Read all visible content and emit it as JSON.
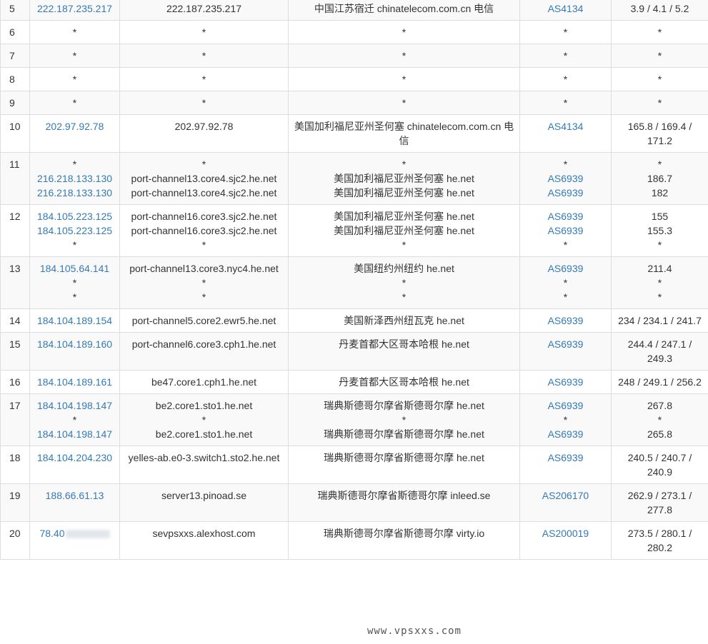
{
  "rows": [
    {
      "hop": "5",
      "ip": [
        "222.187.235.217"
      ],
      "host": [
        "222.187.235.217"
      ],
      "geo": [
        "中国江苏宿迁 chinatelecom.com.cn 电信"
      ],
      "as": [
        "AS4134"
      ],
      "rtt": [
        "3.9 / 4.1 / 5.2"
      ]
    },
    {
      "hop": "6",
      "ip": [
        "*"
      ],
      "host": [
        "*"
      ],
      "geo": [
        "*"
      ],
      "as": [
        "*"
      ],
      "rtt": [
        "*"
      ]
    },
    {
      "hop": "7",
      "ip": [
        "*"
      ],
      "host": [
        "*"
      ],
      "geo": [
        "*"
      ],
      "as": [
        "*"
      ],
      "rtt": [
        "*"
      ]
    },
    {
      "hop": "8",
      "ip": [
        "*"
      ],
      "host": [
        "*"
      ],
      "geo": [
        "*"
      ],
      "as": [
        "*"
      ],
      "rtt": [
        "*"
      ]
    },
    {
      "hop": "9",
      "ip": [
        "*"
      ],
      "host": [
        "*"
      ],
      "geo": [
        "*"
      ],
      "as": [
        "*"
      ],
      "rtt": [
        "*"
      ]
    },
    {
      "hop": "10",
      "ip": [
        "202.97.92.78"
      ],
      "host": [
        "202.97.92.78"
      ],
      "geo": [
        "美国加利福尼亚州圣何塞 chinatelecom.com.cn 电信"
      ],
      "as": [
        "AS4134"
      ],
      "rtt": [
        "165.8 / 169.4 / 171.2"
      ]
    },
    {
      "hop": "11",
      "ip": [
        "*",
        "216.218.133.130",
        "216.218.133.130"
      ],
      "host": [
        "*",
        "port-channel13.core4.sjc2.he.net",
        "port-channel13.core4.sjc2.he.net"
      ],
      "geo": [
        "*",
        "美国加利福尼亚州圣何塞 he.net",
        "美国加利福尼亚州圣何塞 he.net"
      ],
      "as": [
        "*",
        "AS6939",
        "AS6939"
      ],
      "rtt": [
        "*",
        "186.7",
        "182"
      ]
    },
    {
      "hop": "12",
      "ip": [
        "184.105.223.125",
        "184.105.223.125",
        "*"
      ],
      "host": [
        "port-channel16.core3.sjc2.he.net",
        "port-channel16.core3.sjc2.he.net",
        "*"
      ],
      "geo": [
        "美国加利福尼亚州圣何塞 he.net",
        "美国加利福尼亚州圣何塞 he.net",
        "*"
      ],
      "as": [
        "AS6939",
        "AS6939",
        "*"
      ],
      "rtt": [
        "155",
        "155.3",
        "*"
      ]
    },
    {
      "hop": "13",
      "ip": [
        "184.105.64.141",
        "*",
        "*"
      ],
      "host": [
        "port-channel13.core3.nyc4.he.net",
        "*",
        "*"
      ],
      "geo": [
        "美国纽约州纽约 he.net",
        "*",
        "*"
      ],
      "as": [
        "AS6939",
        "*",
        "*"
      ],
      "rtt": [
        "211.4",
        "*",
        "*"
      ]
    },
    {
      "hop": "14",
      "ip": [
        "184.104.189.154"
      ],
      "host": [
        "port-channel5.core2.ewr5.he.net"
      ],
      "geo": [
        "美国新泽西州纽瓦克 he.net"
      ],
      "as": [
        "AS6939"
      ],
      "rtt": [
        "234 / 234.1 / 241.7"
      ]
    },
    {
      "hop": "15",
      "ip": [
        "184.104.189.160"
      ],
      "host": [
        "port-channel6.core3.cph1.he.net"
      ],
      "geo": [
        "丹麦首都大区哥本哈根 he.net"
      ],
      "as": [
        "AS6939"
      ],
      "rtt": [
        "244.4 / 247.1 / 249.3"
      ]
    },
    {
      "hop": "16",
      "ip": [
        "184.104.189.161"
      ],
      "host": [
        "be47.core1.cph1.he.net"
      ],
      "geo": [
        "丹麦首都大区哥本哈根 he.net"
      ],
      "as": [
        "AS6939"
      ],
      "rtt": [
        "248 / 249.1 / 256.2"
      ]
    },
    {
      "hop": "17",
      "ip": [
        "184.104.198.147",
        "*",
        "184.104.198.147"
      ],
      "host": [
        "be2.core1.sto1.he.net",
        "*",
        "be2.core1.sto1.he.net"
      ],
      "geo": [
        "瑞典斯德哥尔摩省斯德哥尔摩 he.net",
        "*",
        "瑞典斯德哥尔摩省斯德哥尔摩 he.net"
      ],
      "as": [
        "AS6939",
        "*",
        "AS6939"
      ],
      "rtt": [
        "267.8",
        "*",
        "265.8"
      ]
    },
    {
      "hop": "18",
      "ip": [
        "184.104.204.230"
      ],
      "host": [
        "yelles-ab.e0-3.switch1.sto2.he.net"
      ],
      "geo": [
        "瑞典斯德哥尔摩省斯德哥尔摩 he.net"
      ],
      "as": [
        "AS6939"
      ],
      "rtt": [
        "240.5 / 240.7 / 240.9"
      ]
    },
    {
      "hop": "19",
      "ip": [
        "188.66.61.13"
      ],
      "host": [
        "server13.pinoad.se"
      ],
      "geo": [
        "瑞典斯德哥尔摩省斯德哥尔摩 inleed.se"
      ],
      "as": [
        "AS206170"
      ],
      "rtt": [
        "262.9 / 273.1 / 277.8"
      ]
    },
    {
      "hop": "20",
      "ip": [
        "78.40"
      ],
      "host": [
        "sevpsxxs.alexhost.com"
      ],
      "geo": [
        "瑞典斯德哥尔摩省斯德哥尔摩 virty.io"
      ],
      "as": [
        "AS200019"
      ],
      "rtt": [
        "273.5 / 280.1 / 280.2"
      ]
    }
  ],
  "watermark": "www.vpsxxs.com",
  "colors": {
    "link": "#337ab7",
    "stripe": "#f9f9f9",
    "border": "#dddddd"
  }
}
